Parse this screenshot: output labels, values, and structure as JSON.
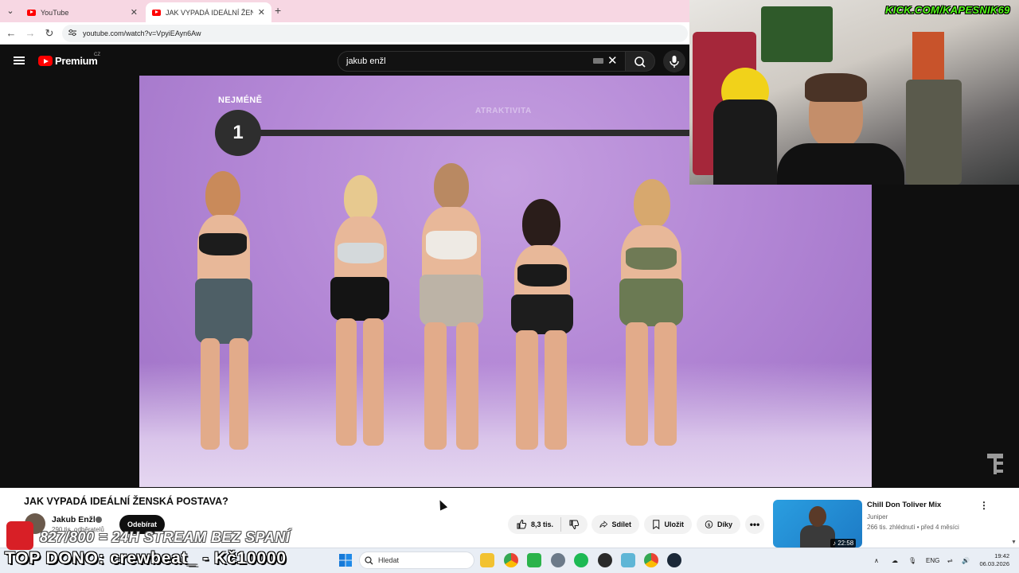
{
  "browser": {
    "tabs": [
      {
        "title": "YouTube"
      },
      {
        "title": "JAK VYPADÁ IDEÁLNÍ ŽENSKÁ P"
      }
    ],
    "url": "youtube.com/watch?v=VpyiEAyn6Aw"
  },
  "masthead": {
    "brand": "Premium",
    "region": "CZ",
    "search_value": "jakub enžl"
  },
  "video_overlay": {
    "left_label": "NEJMÉNĚ",
    "center_label": "ATRAKTIVITA",
    "rank_number": "1"
  },
  "webcam": {
    "kick_label": "KICK.COM/KAPESNIK69"
  },
  "video_info": {
    "title": "JAK VYPADÁ IDEÁLNÍ ŽENSKÁ POSTAVA?",
    "channel": "Jakub Enžl",
    "subscribers": "290 tis. odběratelů",
    "subscribe_label": "Odebírat",
    "likes": "8,3 tis.",
    "share_label": "Sdílet",
    "save_label": "Uložit",
    "thanks_label": "Díky"
  },
  "recommended": {
    "title": "Chill Don Toliver Mix",
    "channel": "Juniper",
    "meta": "266 tis. zhlédnutí • před 4 měsíci",
    "duration": "22:58"
  },
  "taskbar": {
    "search_placeholder": "Hledat",
    "lang": "ENG",
    "time": "19:42",
    "date": "06.03.2026"
  },
  "stream_overlay": {
    "goal_line": "827/800 = 24H STREAM BEZ SPANÍ",
    "top_donation": "TOP DONO: crewbeat_ - Kč10000"
  },
  "colors": {
    "yt_red": "#ff0000",
    "kick_green": "#53fc18",
    "video_purple": "#b488d6"
  }
}
